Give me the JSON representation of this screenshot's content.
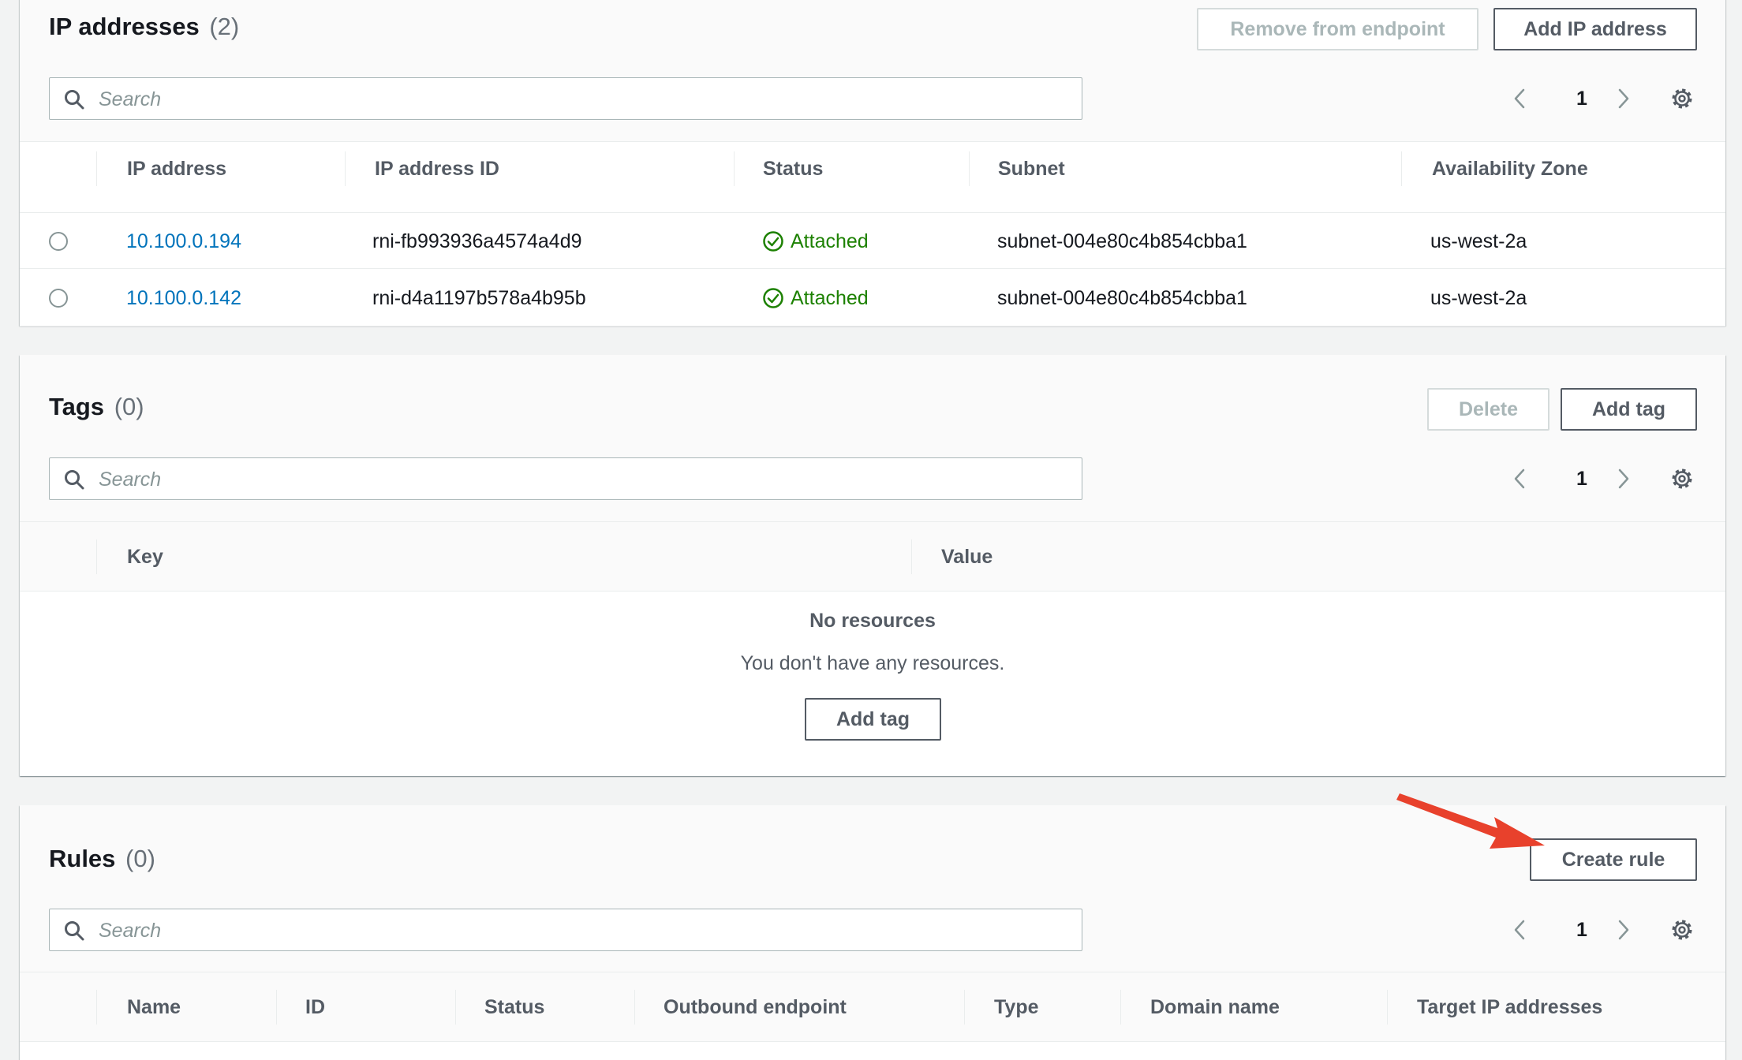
{
  "ip_panel": {
    "title": "IP addresses",
    "count": "(2)",
    "remove_button": "Remove from endpoint",
    "add_button": "Add IP address",
    "search_placeholder": "Search",
    "page": "1",
    "columns": [
      "IP address",
      "IP address ID",
      "Status",
      "Subnet",
      "Availability Zone"
    ],
    "rows": [
      {
        "ip": "10.100.0.194",
        "id": "rni-fb993936a4574a4d9",
        "status": "Attached",
        "subnet": "subnet-004e80c4b854cbba1",
        "az": "us-west-2a"
      },
      {
        "ip": "10.100.0.142",
        "id": "rni-d4a1197b578a4b95b",
        "status": "Attached",
        "subnet": "subnet-004e80c4b854cbba1",
        "az": "us-west-2a"
      }
    ]
  },
  "tags_panel": {
    "title": "Tags",
    "count": "(0)",
    "delete_button": "Delete",
    "add_button": "Add tag",
    "search_placeholder": "Search",
    "page": "1",
    "columns": [
      "Key",
      "Value"
    ],
    "empty_title": "No resources",
    "empty_text": "You don't have any resources.",
    "empty_button": "Add tag"
  },
  "rules_panel": {
    "title": "Rules",
    "count": "(0)",
    "create_button": "Create rule",
    "search_placeholder": "Search",
    "page": "1",
    "columns": [
      "Name",
      "ID",
      "Status",
      "Outbound endpoint",
      "Type",
      "Domain name",
      "Target IP addresses"
    ]
  },
  "colors": {
    "link": "#0073bb",
    "success": "#1d8102",
    "annotation_arrow": "#e8412c"
  },
  "icons": [
    "search-icon",
    "chevron-left-icon",
    "chevron-right-icon",
    "gear-icon",
    "check-circle-icon",
    "annotation-arrow"
  ]
}
